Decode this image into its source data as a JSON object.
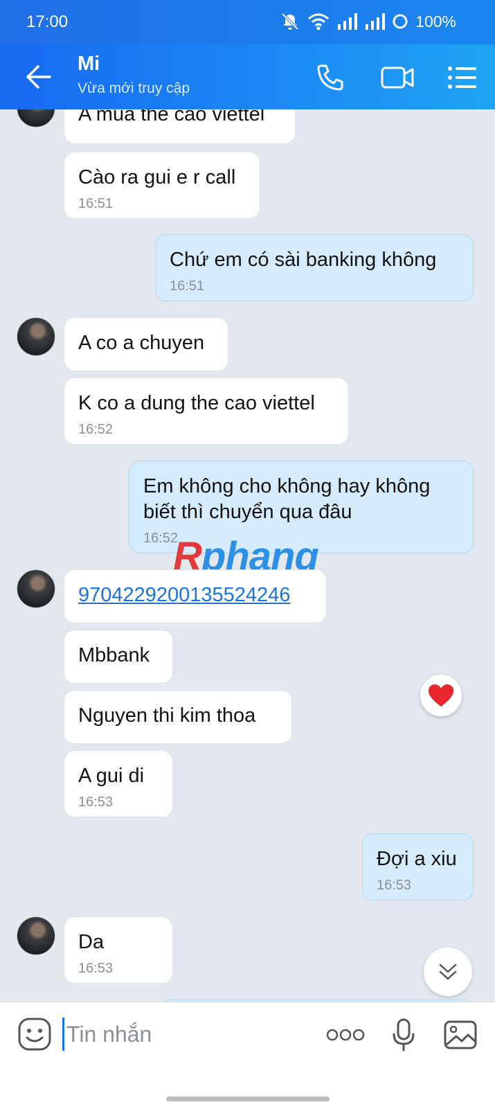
{
  "status_bar": {
    "time": "17:00",
    "battery": "100%"
  },
  "header": {
    "contact_name": "Mi",
    "contact_status": "Vừa mới truy cập"
  },
  "messages": [
    {
      "side": "in",
      "text": "A mua the cao viettel",
      "time": ""
    },
    {
      "side": "in",
      "text": "Cào ra gui e r call",
      "time": "16:51"
    },
    {
      "side": "out",
      "text": "Chứ em có sài banking không",
      "time": "16:51"
    },
    {
      "side": "in",
      "text": "A co a chuyen",
      "time": ""
    },
    {
      "side": "in",
      "text": "K co a dung the cao viettel",
      "time": "16:52"
    },
    {
      "side": "out",
      "text": "Em không cho không hay không biết thì chuyển qua đâu",
      "time": "16:52"
    },
    {
      "side": "in",
      "text": "9704229200135524246",
      "time": "",
      "is_link": true
    },
    {
      "side": "in",
      "text": "Mbbank",
      "time": ""
    },
    {
      "side": "in",
      "text": "Nguyen thi kim thoa",
      "time": ""
    },
    {
      "side": "in",
      "text": "A gui di",
      "time": "16:53"
    },
    {
      "side": "out",
      "text": "Đợi a xiu",
      "time": "16:53"
    },
    {
      "side": "in",
      "text": "Da",
      "time": "16:53"
    }
  ],
  "watermark": {
    "first": "R",
    "rest": "phang"
  },
  "input": {
    "placeholder": "Tin nhắn"
  },
  "colors": {
    "header": "#1b86f0",
    "outgoing_bubble": "#d4ecfd",
    "incoming_bubble": "#ffffff",
    "chat_background": "#e3e8ef"
  }
}
